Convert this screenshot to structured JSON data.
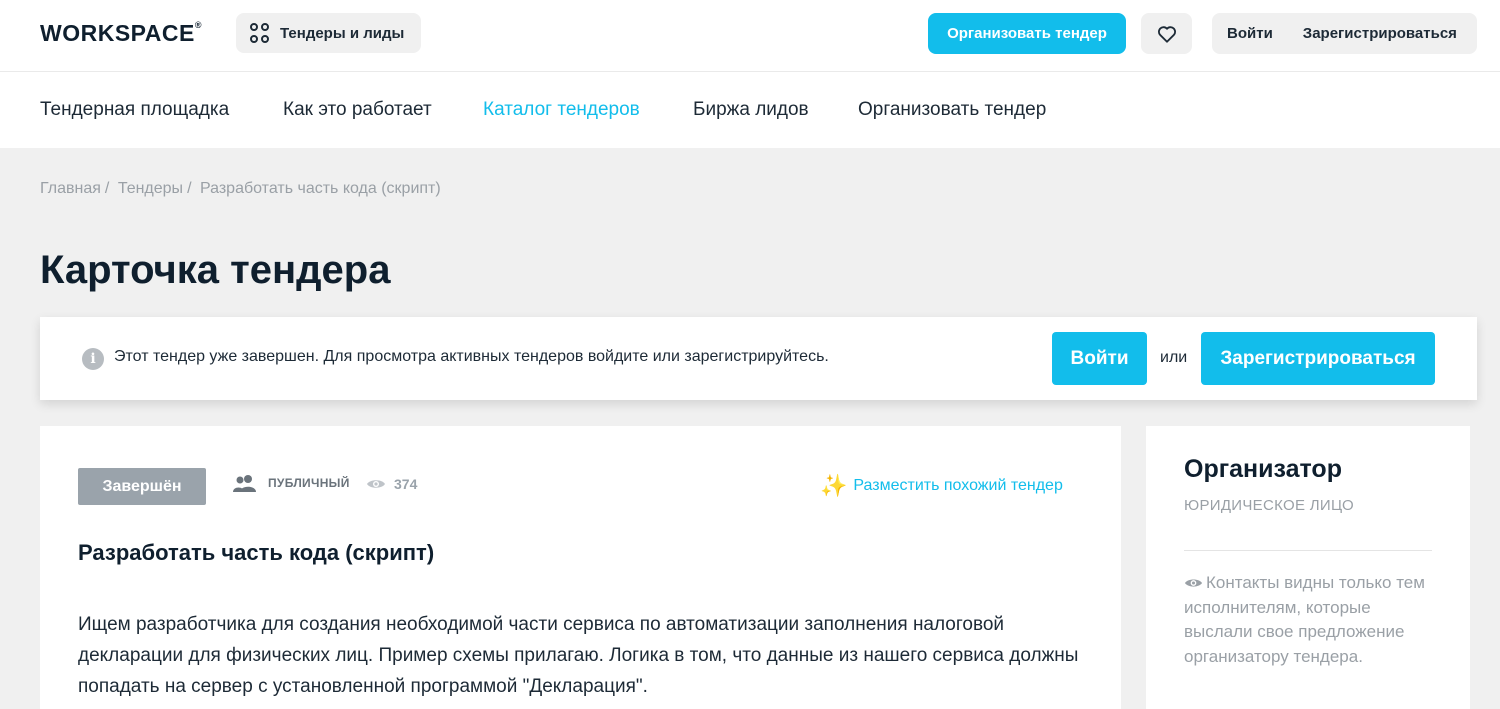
{
  "header": {
    "logo": "WORKSPACE",
    "logo_mark": "®",
    "tenders_leads_button": "Тендеры и лиды",
    "organize_button": "Организовать тендер",
    "login_label": "Войти",
    "register_label": "Зарегистрироваться"
  },
  "nav": {
    "items": [
      {
        "label": "Тендерная площадка"
      },
      {
        "label": "Как это работает"
      },
      {
        "label": "Каталог тендеров",
        "active": true
      },
      {
        "label": "Биржа лидов"
      },
      {
        "label": "Организовать тендер"
      }
    ]
  },
  "breadcrumb": {
    "items": [
      "Главная",
      "Тендеры",
      "Разработать часть кода (скрипт)"
    ],
    "separator": "/"
  },
  "page": {
    "title": "Карточка тендера"
  },
  "notice": {
    "message": "Этот тендер уже завершен. Для просмотра активных тендеров войдите или зарегистрируйтесь.",
    "login_button": "Войти",
    "or_label": "или",
    "register_button": "Зарегистрироваться"
  },
  "tender": {
    "status": "Завершён",
    "visibility": "ПУБЛИЧНЫЙ",
    "views": "374",
    "similar_link": "Разместить похожий тендер",
    "title": "Разработать часть кода (скрипт)",
    "description": "Ищем разработчика для создания необходимой части сервиса по автоматизации заполнения налоговой декларации для физических лиц. Пример схемы прилагаю. Логика в том, что данные из нашего сервиса должны попадать на сервер с установленной программой \"Декларация\"."
  },
  "organizer": {
    "heading": "Организатор",
    "type": "ЮРИДИЧЕСКОЕ ЛИЦО",
    "contacts_note": "Контакты видны только тем исполнителям, которые выслали свое предложение организатору тендера."
  },
  "colors": {
    "accent": "#12bdeb",
    "text_dark": "#0f1f2e",
    "muted": "#9aa0a6",
    "status_badge": "#9aa3ab",
    "background": "#f0f0f0"
  }
}
